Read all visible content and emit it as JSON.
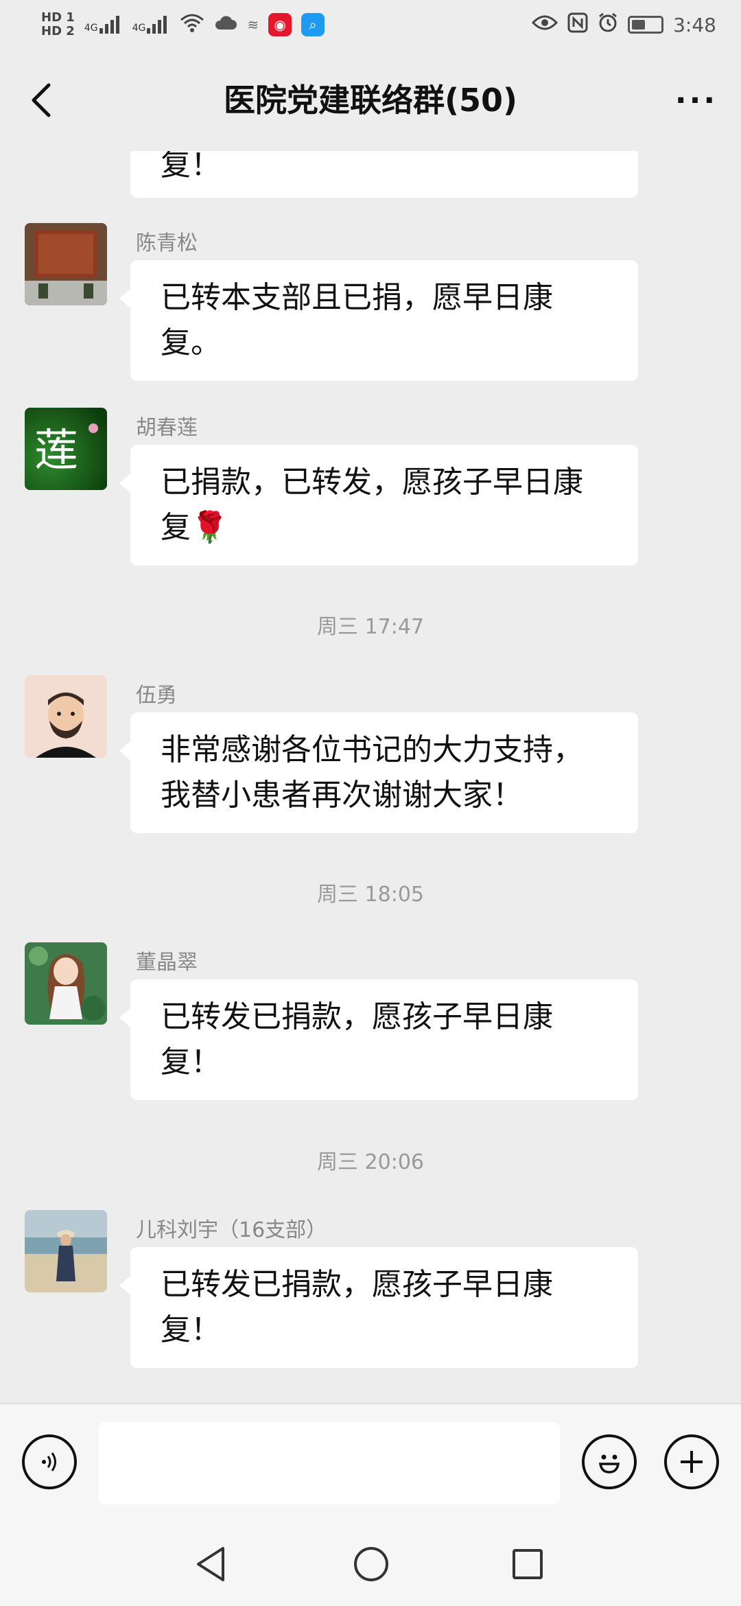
{
  "status_bar": {
    "sim1": "HD 1",
    "sim2": "HD 2",
    "net1": "4G",
    "net2": "4G",
    "time": "3:48"
  },
  "header": {
    "title": "医院党建联络群(50)",
    "back_icon": "chevron-left-icon",
    "more_icon": "more-dots-icon"
  },
  "messages": [
    {
      "sender": "",
      "text": "复！",
      "avatar": "none"
    },
    {
      "sender": "陈青松",
      "text": "已转本支部且已捐，愿早日康复。",
      "avatar": "building-photo"
    },
    {
      "sender": "胡春莲",
      "text": "已捐款，已转发，愿孩子早日康复🌹",
      "avatar": "lotus-character"
    },
    {
      "sender": "伍勇",
      "text": "非常感谢各位书记的大力支持，我替小患者再次谢谢大家！",
      "avatar": "cartoon-man"
    },
    {
      "sender": "董晶翠",
      "text": "已转发已捐款，愿孩子早日康复！",
      "avatar": "cartoon-girl"
    },
    {
      "sender": "儿科刘宇（16支部）",
      "text": "已转发已捐款，愿孩子早日康复！",
      "avatar": "beach-photo"
    }
  ],
  "timestamps": [
    "周三 17:47",
    "周三 18:05",
    "周三 20:06"
  ],
  "input_bar": {
    "placeholder": "",
    "voice_icon": "voice-icon",
    "emoji_icon": "emoji-icon",
    "plus_icon": "plus-icon"
  },
  "nav_bar": {
    "back_icon": "nav-back-icon",
    "home_icon": "nav-home-icon",
    "recent_icon": "nav-recent-icon"
  }
}
